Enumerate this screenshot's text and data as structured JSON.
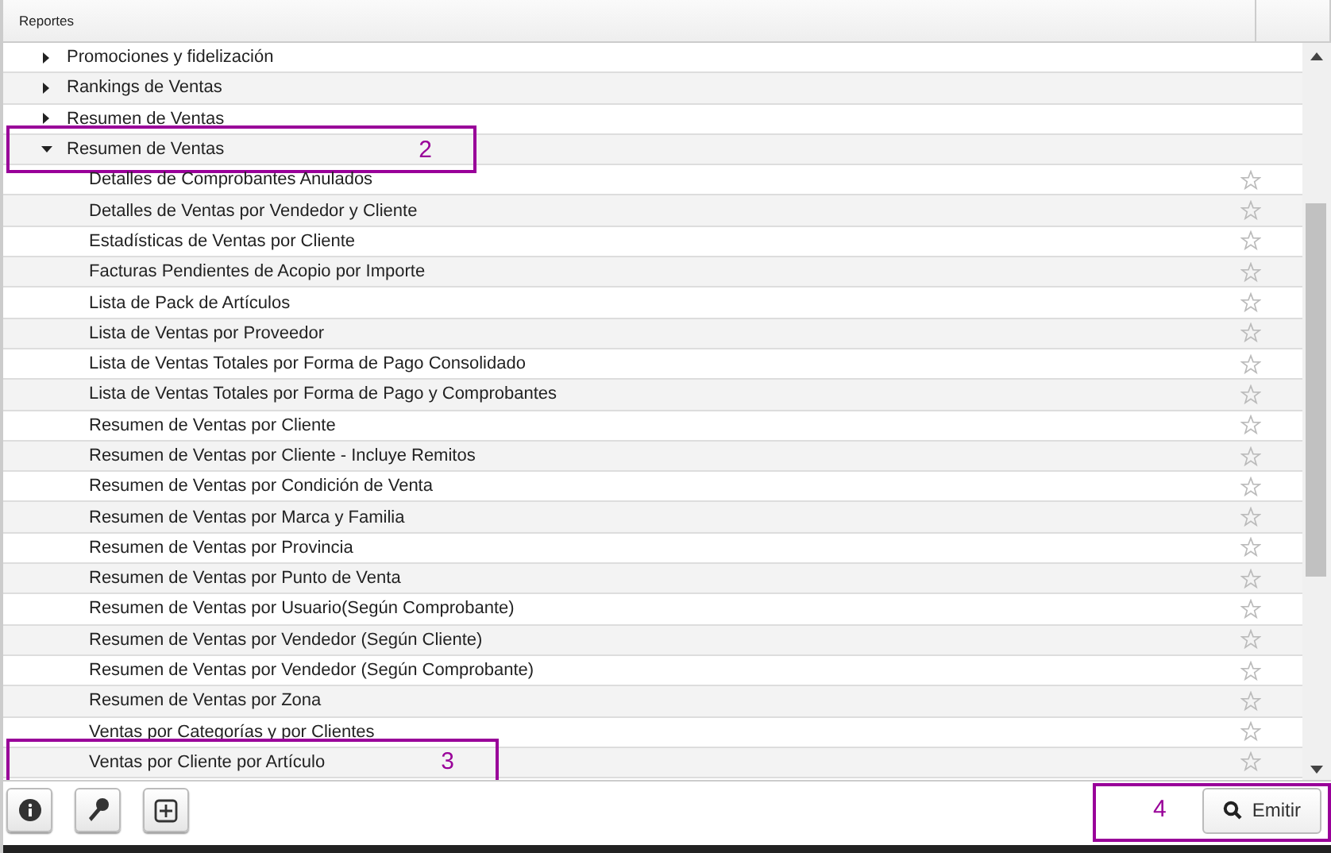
{
  "header": {
    "title": "Reportes"
  },
  "groups": [
    {
      "label": "Promociones y fidelización",
      "expanded": false
    },
    {
      "label": "Rankings de Ventas",
      "expanded": false
    },
    {
      "label": "Resumen de Ventas",
      "expanded": false
    },
    {
      "label": "Resumen de Ventas",
      "expanded": true,
      "callout": "2",
      "children": [
        {
          "label": "Detalles de Comprobantes Anulados",
          "favorite": false
        },
        {
          "label": "Detalles de Ventas por Vendedor y Cliente",
          "favorite": false
        },
        {
          "label": "Estadísticas de Ventas por Cliente",
          "favorite": false
        },
        {
          "label": "Facturas Pendientes de Acopio por Importe",
          "favorite": false
        },
        {
          "label": "Lista de Pack de Artículos",
          "favorite": false
        },
        {
          "label": "Lista de Ventas por Proveedor",
          "favorite": false
        },
        {
          "label": "Lista de Ventas Totales por Forma de Pago Consolidado",
          "favorite": false
        },
        {
          "label": "Lista de Ventas Totales por Forma de Pago y Comprobantes",
          "favorite": false
        },
        {
          "label": "Resumen de Ventas por Cliente",
          "favorite": false
        },
        {
          "label": "Resumen de Ventas por Cliente - Incluye Remitos",
          "favorite": false
        },
        {
          "label": "Resumen de Ventas por Condición de Venta",
          "favorite": false
        },
        {
          "label": "Resumen de Ventas por Marca y Familia",
          "favorite": false
        },
        {
          "label": "Resumen de Ventas por Provincia",
          "favorite": false
        },
        {
          "label": "Resumen de Ventas por Punto de Venta",
          "favorite": false
        },
        {
          "label": "Resumen de Ventas por Usuario(Según Comprobante)",
          "favorite": false
        },
        {
          "label": "Resumen de Ventas por Vendedor (Según Cliente)",
          "favorite": false
        },
        {
          "label": "Resumen de Ventas por Vendedor (Según Comprobante)",
          "favorite": false
        },
        {
          "label": "Resumen de Ventas por Zona",
          "favorite": false
        },
        {
          "label": "Ventas por Categorías y por Clientes",
          "favorite": false
        },
        {
          "label": "Ventas por Cliente por Artículo",
          "favorite": false,
          "callout": "3"
        }
      ]
    }
  ],
  "footer": {
    "tools": [
      {
        "kind": "info"
      },
      {
        "kind": "key"
      },
      {
        "kind": "add"
      }
    ],
    "emit_button": {
      "label": "Emitir",
      "callout": "4"
    }
  }
}
